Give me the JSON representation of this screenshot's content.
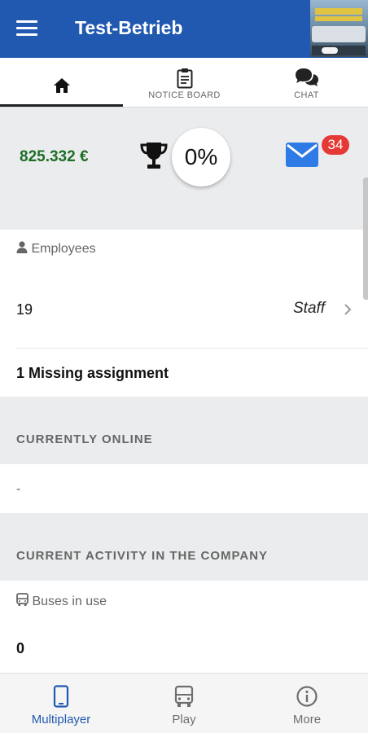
{
  "app": {
    "title": "Test-Betrieb"
  },
  "tabs": [
    {
      "label": "",
      "icon": "home-icon",
      "active": true
    },
    {
      "label": "NOTICE BOARD",
      "icon": "clipboard-icon",
      "active": false
    },
    {
      "label": "CHAT",
      "icon": "chat-icon",
      "active": false
    }
  ],
  "stats": {
    "balance": "825.332 €",
    "progress": "0%",
    "unread_messages": "34"
  },
  "employees": {
    "section_label": "Employees",
    "count": "19",
    "staff_link": "Staff",
    "missing_assignment": "1 Missing assignment"
  },
  "online": {
    "title": "CURRENTLY ONLINE",
    "value": "-"
  },
  "activity": {
    "title": "CURRENT ACTIVITY IN THE COMPANY",
    "buses_label": "Buses in use",
    "buses_value": "0"
  },
  "bottom_nav": [
    {
      "label": "Multiplayer",
      "icon": "phone-icon",
      "active": true
    },
    {
      "label": "Play",
      "icon": "bus-icon",
      "active": false
    },
    {
      "label": "More",
      "icon": "info-icon",
      "active": false
    }
  ],
  "colors": {
    "primary": "#2159b1",
    "balance_green": "#1e6e26",
    "badge_red": "#e53935",
    "band_gray": "#ebecee"
  }
}
